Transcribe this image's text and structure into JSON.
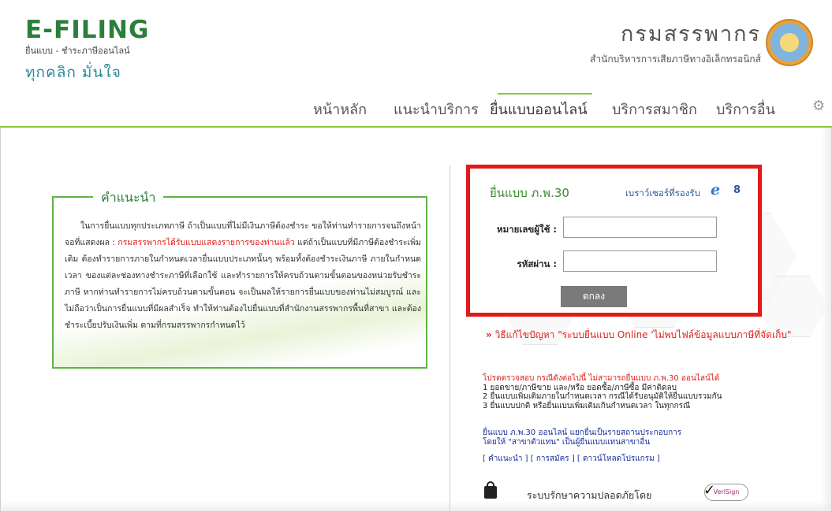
{
  "header": {
    "logo_title": "E-FILING",
    "logo_sub": "ยื่นแบบ - ชำระภาษีออนไลน์",
    "logo_slogan": "ทุกคลิก มั่นใจ",
    "dept_name": "กรมสรรพากร",
    "dept_sub": "สำนักบริหารการเสียภาษีทางอิเล็กทรอนิกส์"
  },
  "nav": {
    "items": [
      {
        "label": "หน้าหลัก"
      },
      {
        "label": "แนะนำบริการ"
      },
      {
        "label": "ยื่นแบบออนไลน์"
      },
      {
        "label": "บริการสมาชิก"
      },
      {
        "label": "บริการอื่น"
      }
    ],
    "active_index": 2
  },
  "advice": {
    "title": "คำแนะนำ",
    "text_part1": "ในการยื่นแบบทุกประเภทภาษี ถ้าเป็นแบบที่ไม่มีเงินภาษีต้องชำระ ขอให้ท่านทำรายการจนถึงหน้าจอที่แสดงผล : ",
    "text_red": "กรมสรรพากรได้รับแบบแสดงรายการของท่านแล้ว",
    "text_part2": " แต่ถ้าเป็นแบบที่มีภาษีต้องชำระเพิ่มเติม ต้องทำรายการภายในกำหนดเวลายื่นแบบประเภทนั้นๆ พร้อมทั้งต้องชำระเงินภาษี ภายในกำหนดเวลา ของแต่ละช่องทางชำระภาษีที่เลือกใช้ และทำรายการให้ครบถ้วนตามขั้นตอนของหน่วยรับชำระภาษี หากท่านทำรายการไม่ครบถ้วนตามขั้นตอน จะเป็นผลให้รายการยื่นแบบของท่านไม่สมบูรณ์ และไม่ถือว่าเป็นการยื่นแบบที่มีผลสำเร็จ ทำให้ท่านต้องไปยื่นแบบที่สำนักงานสรรพากรพื้นที่สาขา และต้องชำระเบี้ยปรับเงินเพิ่ม ตามที่กรมสรรพากรกำหนดไว้"
  },
  "login": {
    "title": "ยื่นแบบ ภ.พ.30",
    "browser_label": "เบราว์เซอร์ที่รองรับ",
    "browser_version": "8",
    "username_label": "หมายเลขผู้ใช้ :",
    "username_value": "",
    "password_label": "รหัสผ่าน :",
    "password_value": "",
    "submit_label": "ตกลง"
  },
  "help": {
    "prefix": "»",
    "text": "วิธีแก้ไขปัญหา \"ระบบยื่นแบบ Online 'ไม่พบไฟล์ข้อมูลแบบภาษีที่จัดเก็บ\""
  },
  "notice": {
    "heading": "โปรดตรวจสอบ กรณีดังต่อไปนี้ ไม่สามารถยื่นแบบ ภ.พ.30 ออนไลน์ได้",
    "lines": [
      "1 ยอดขาย/ภาษีขาย และ/หรือ ยอดซื้อ/ภาษีซื้อ มีค่าติดลบ",
      "2 ยื่นแบบเพิ่มเติมภายในกำหนดเวลา กรณีได้รับอนุมัติให้ยื่นแบบรวมกัน",
      "3 ยื่นแบบปกติ หรือยื่นแบบเพิ่มเติมเกินกำหนดเวลา ในทุกกรณี"
    ]
  },
  "branch_note": {
    "line1": "ยื่นแบบ ภ.พ.30 ออนไลน์ แยกยื่นเป็นรายสถานประกอบการ",
    "line2": "โดยให้ \"สาขาตัวแทน\" เป็นผู้ยื่นแบบแทนสาขาอื่น",
    "links": [
      "[ คำแนะนำ ]",
      "[ การสมัคร ]",
      "[ ดาวน์โหลดโปรแกรม ]"
    ]
  },
  "security": {
    "text": "ระบบรักษาความปลอดภัยโดย",
    "badge_text": "VeriSign"
  },
  "colors": {
    "brand_green": "#2a7f3a",
    "accent_green": "#8cc63f",
    "alert_red": "#e21a1a",
    "link_blue": "#1a2f9a"
  }
}
